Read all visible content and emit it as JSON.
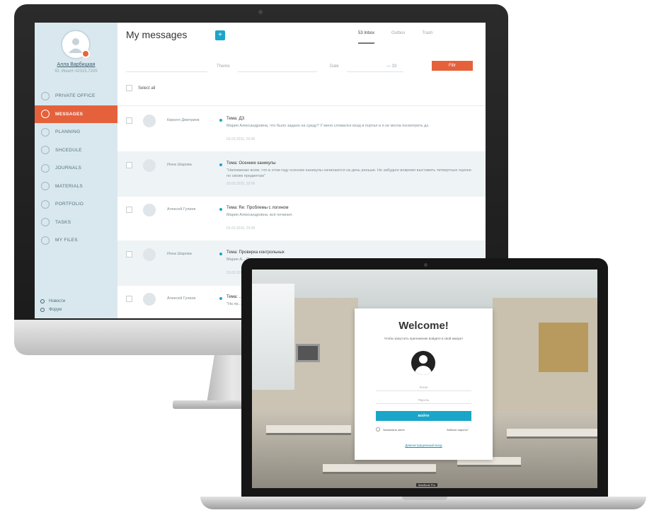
{
  "desktop": {
    "user": {
      "name": "Алла Варбицкая",
      "sub": "ID: ИошН.Ч2315.7205"
    },
    "menu": [
      {
        "label": "PRIVATE OFFICE",
        "active": false
      },
      {
        "label": "MESSAGES",
        "active": true
      },
      {
        "label": "PLANNING",
        "active": false
      },
      {
        "label": "SHCEDULE",
        "active": false
      },
      {
        "label": "JOURNALS",
        "active": false
      },
      {
        "label": "MATERIALS",
        "active": false
      },
      {
        "label": "PORTFOLIO",
        "active": false
      },
      {
        "label": "TASKS",
        "active": false
      },
      {
        "label": "MY FILES",
        "active": false
      }
    ],
    "side_links": [
      "Новости",
      "Форум"
    ],
    "title": "My messages",
    "add_symbol": "+",
    "tabs": [
      "53 Inbox",
      "Outbox",
      "Trash"
    ],
    "filters": {
      "theme_label": "Theme",
      "date_label": "Date",
      "date_separator": "— 33",
      "button": "Filtr"
    },
    "select_all": "Select all",
    "messages": [
      {
        "sender": "Кирилл Дмитриев",
        "subject": "Тема: ДЗ",
        "body": "Мария Александровна, что было задано на среду? У меня сломался вход в портал и я не могла посмотреть дз.",
        "date": "03.03.2015, 20:06"
      },
      {
        "sender": "Инна Шарова",
        "subject": "Тема: Осенние каникулы",
        "body": "\"Напоминаю всем, что в этом году осенние каникулы начинаются на день раньше. Не забудьте вовремя выставить четвертные оценки по своим предметам\"",
        "date": "03.03.2015, 20:06"
      },
      {
        "sender": "Алексей Гулиев",
        "subject": "Тема: Re: Проблемы с логином",
        "body": "Мария Александровна, всё починил.",
        "date": "03.03.2015, 20:06"
      },
      {
        "sender": "Инна Шарова",
        "subject": "Тема: Проверка контрольных",
        "body": "Мария А... Пожал...",
        "date": "03.03.2015"
      },
      {
        "sender": "Алексей Гулиев",
        "subject": "Тема: ...",
        "body": "\"На пр... возм...",
        "date": ""
      }
    ]
  },
  "laptop": {
    "title": "Welcome!",
    "subtitle": "Чтобы запустить приложение войдите в свой аккаунт",
    "login_placeholder": "Логин",
    "password_placeholder": "Пароль",
    "button": "ВОЙТИ",
    "remember": "Запомнить меня",
    "forgot": "Забыли пароль?",
    "guest_link": "Демонстрационный вход",
    "bottom_label": "MacBook Pro"
  },
  "colors": {
    "accent": "#e5613c",
    "primary": "#1aa6c8",
    "sidebar": "#d9e8ee"
  }
}
